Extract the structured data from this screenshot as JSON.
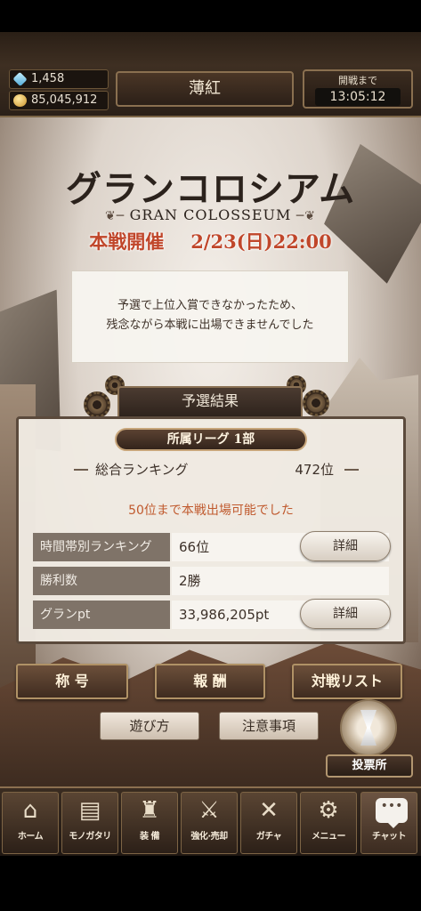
{
  "resources": {
    "gems": "1,458",
    "gold": "85,045,912"
  },
  "header": {
    "player_name": "薄紅",
    "timer_label": "開戦まで",
    "timer_value": "13:05:12"
  },
  "event": {
    "title_jp": "グランコロシアム",
    "title_en": "GRAN COLOSSEUM",
    "main_label": "本戦開催",
    "main_date": "2/23(日)22:00",
    "notice_line1": "予選で上位入賞できなかったため、",
    "notice_line2": "残念ながら本戦に出場できませんでした"
  },
  "results": {
    "tab_label": "予選結果",
    "league": "所属リーグ 1部",
    "overall_label": "総合ランキング",
    "overall_value": "472位",
    "qualify_note": "50位まで本戦出場可能でした",
    "rows": [
      {
        "label": "時間帯別ランキング",
        "value": "66位",
        "button": "詳細"
      },
      {
        "label": "勝利数",
        "value": "2勝"
      },
      {
        "label": "グランpt",
        "value": "33,986,205pt",
        "button": "詳細"
      }
    ]
  },
  "actions": {
    "title_btn": "称 号",
    "reward_btn": "報 酬",
    "match_list_btn": "対戦リスト",
    "howto_btn": "遊び方",
    "caution_btn": "注意事項",
    "vote_booth": "投票所"
  },
  "navbar": {
    "items": [
      {
        "label": "ホーム",
        "icon": "home-icon"
      },
      {
        "label": "モノガタリ",
        "icon": "book-icon"
      },
      {
        "label": "装 備",
        "icon": "armor-icon"
      },
      {
        "label": "強化·売却",
        "icon": "upgrade-icon"
      },
      {
        "label": "ガチャ",
        "icon": "swords-icon"
      },
      {
        "label": "メニュー",
        "icon": "gear-icon"
      },
      {
        "label": "チャット",
        "icon": "chat-icon"
      }
    ],
    "chat_dots": "•••"
  }
}
